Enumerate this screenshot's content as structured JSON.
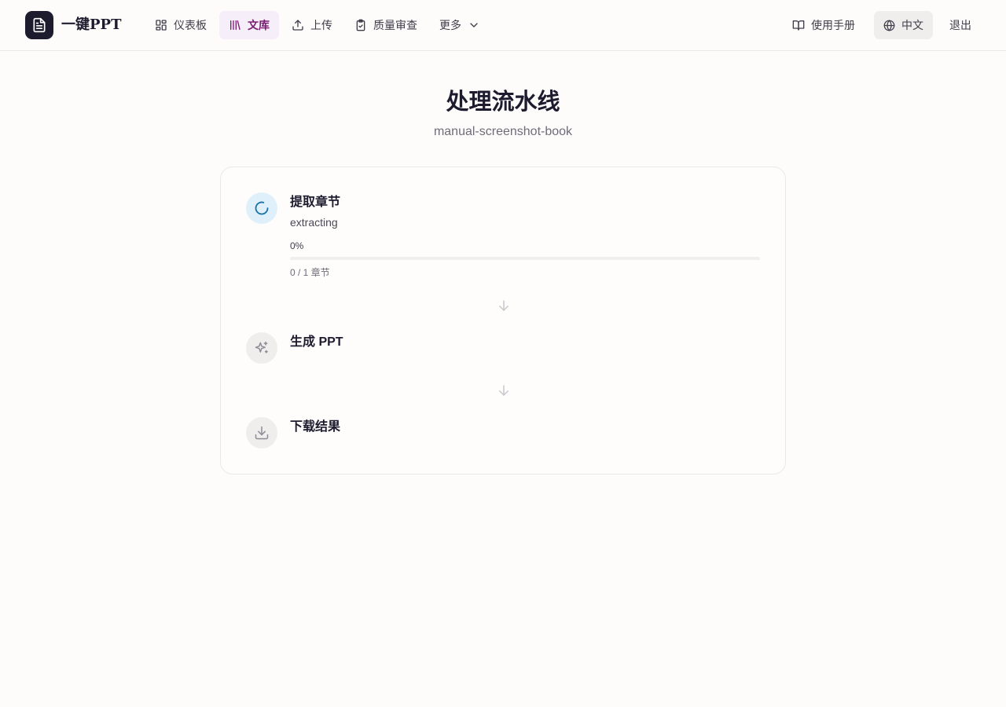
{
  "app": {
    "brand": "一键PPT"
  },
  "nav": {
    "dashboard": "仪表板",
    "library": "文库",
    "upload": "上传",
    "review": "质量审查",
    "more": "更多",
    "manual": "使用手册",
    "language": "中文",
    "logout": "退出"
  },
  "page": {
    "title": "处理流水线",
    "subtitle": "manual-screenshot-book"
  },
  "pipeline": {
    "steps": [
      {
        "title": "提取章节",
        "status": "extracting",
        "progress_label": "0%",
        "progress": 0,
        "count": "0 / 1 章节",
        "icon": "spinner-icon"
      },
      {
        "title": "生成 PPT",
        "icon": "sparkles-icon"
      },
      {
        "title": "下载结果",
        "icon": "download-icon"
      }
    ]
  },
  "colors": {
    "accent": "#7a1d73",
    "active_step_bg": "#e0f0fa",
    "spinner": "#1a73a8",
    "brand_dark": "#1d1b2e"
  }
}
